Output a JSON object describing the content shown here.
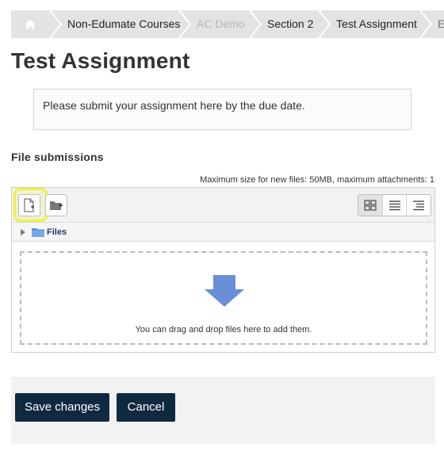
{
  "breadcrumb": {
    "items": [
      {
        "label": "Non-Edumate Courses",
        "disabled": false
      },
      {
        "label": "AC Demo",
        "disabled": true
      },
      {
        "label": "Section 2",
        "disabled": false
      },
      {
        "label": "Test Assignment",
        "disabled": false
      },
      {
        "label": "E",
        "disabled": false
      }
    ]
  },
  "page": {
    "title": "Test Assignment",
    "intro": "Please submit your assignment here by the due date."
  },
  "file_submissions": {
    "label": "File submissions",
    "max_size": "Maximum size for new files: 50MB, maximum attachments: 1",
    "path_folder": "Files",
    "drop_text": "You can drag and drop files here to add them."
  },
  "actions": {
    "save": "Save changes",
    "cancel": "Cancel"
  },
  "colors": {
    "primary_button": "#0f2a40",
    "highlight": "#f0f040",
    "drop_arrow": "#6b8fd6"
  }
}
